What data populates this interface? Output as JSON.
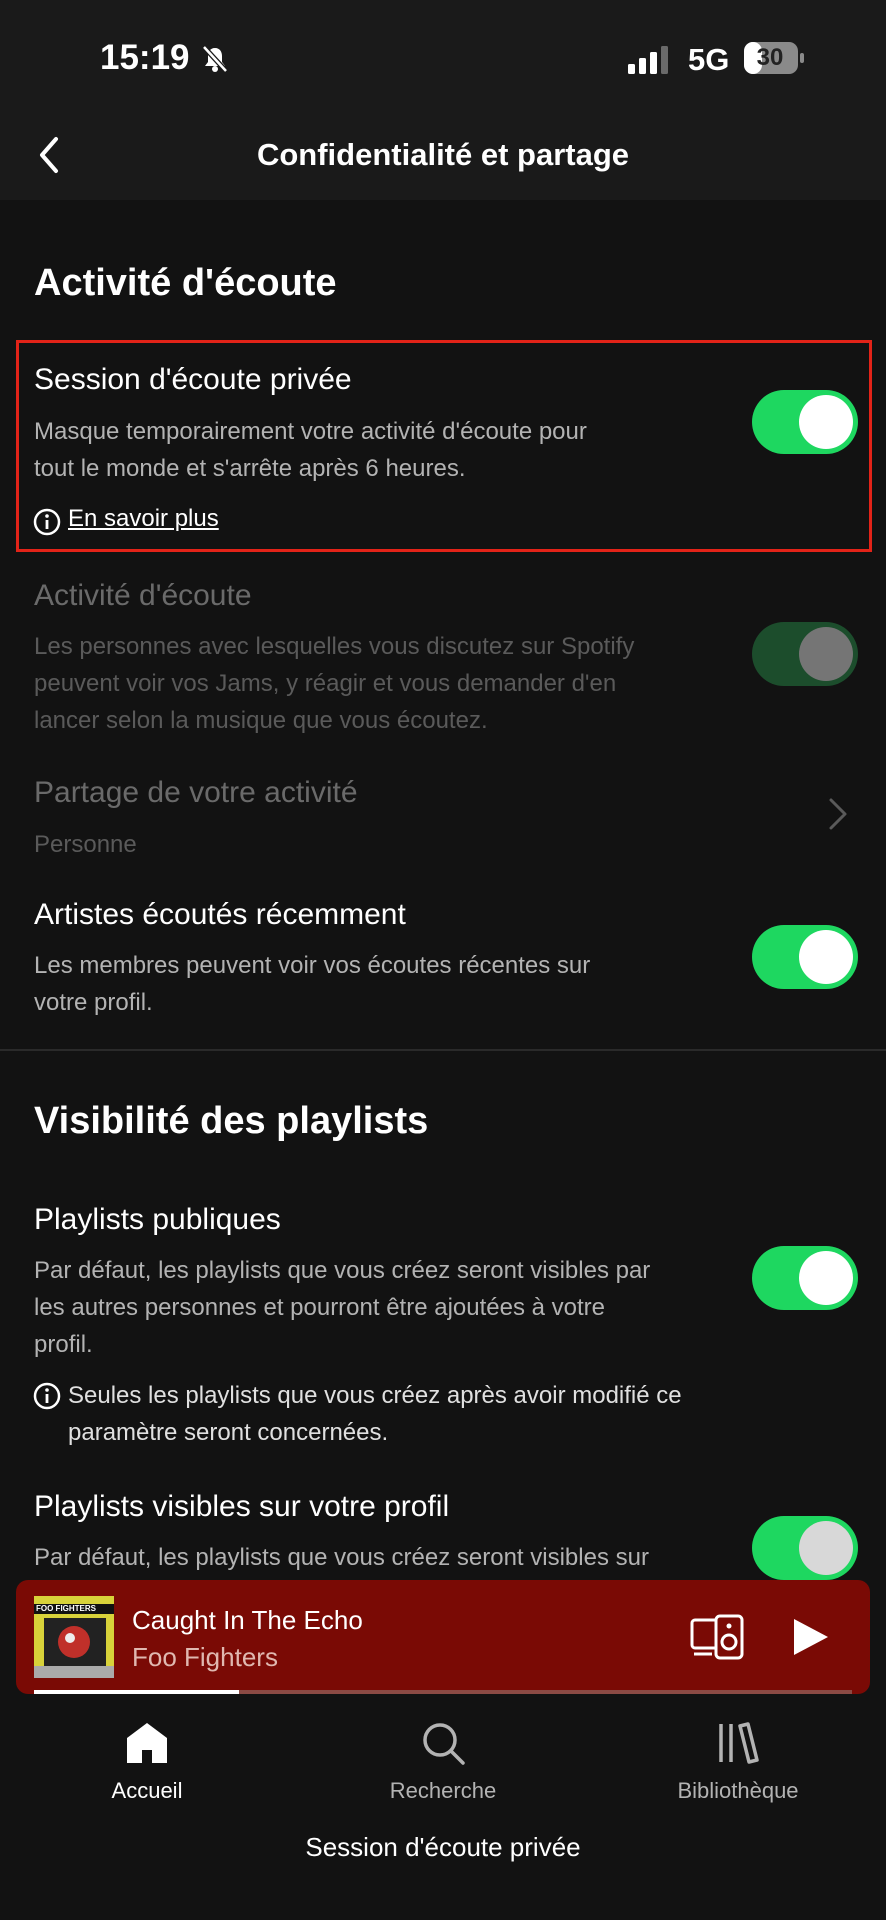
{
  "status_bar": {
    "time": "15:19",
    "network": "5G",
    "battery": "30"
  },
  "header": {
    "title": "Confidentialité et partage"
  },
  "section1": {
    "heading": "Activité d'écoute",
    "private_session": {
      "title": "Session d'écoute privée",
      "description_line1": "Masque temporairement votre activité d'écoute pour",
      "description_line2": "tout le monde et s'arrête après 6 heures.",
      "link": "En savoir plus",
      "enabled": true
    },
    "listening_activity": {
      "title": "Activité d'écoute",
      "description_line1": "Les personnes avec lesquelles vous discutez sur Spotify",
      "description_line2": "peuvent voir vos Jams, y réagir et vous demander d'en",
      "description_line3": "lancer selon la musique que vous écoutez.",
      "enabled": false,
      "disabled": true
    },
    "activity_sharing": {
      "title": "Partage de votre activité",
      "value": "Personne"
    },
    "recent_artists": {
      "title": "Artistes écoutés récemment",
      "description_line1": "Les membres peuvent voir vos écoutes récentes sur",
      "description_line2": "votre profil.",
      "enabled": true
    }
  },
  "section2": {
    "heading": "Visibilité des playlists",
    "public_playlists": {
      "title": "Playlists publiques",
      "description_line1": "Par défaut, les playlists que vous créez seront visibles par",
      "description_line2": "les autres personnes et pourront être ajoutées à votre",
      "description_line3": "profil.",
      "note_line1": "Seules les playlists que vous créez après avoir modifié ce",
      "note_line2": "paramètre seront concernées.",
      "enabled": true
    },
    "profile_playlists": {
      "title": "Playlists visibles sur votre profil",
      "description_line1": "Par défaut, les playlists que vous créez seront visibles sur",
      "enabled": true
    }
  },
  "player": {
    "song": "Caught In The Echo",
    "artist": "Foo Fighters",
    "album_text": "FOO FIGHTERS",
    "progress": 0.25
  },
  "nav": {
    "home": "Accueil",
    "search": "Recherche",
    "library": "Bibliothèque"
  },
  "footer": {
    "text": "Session d'écoute privée"
  },
  "colors": {
    "accent": "#1ed760",
    "background": "#121212",
    "player": "#7a0a05",
    "highlight": "#e22318"
  }
}
